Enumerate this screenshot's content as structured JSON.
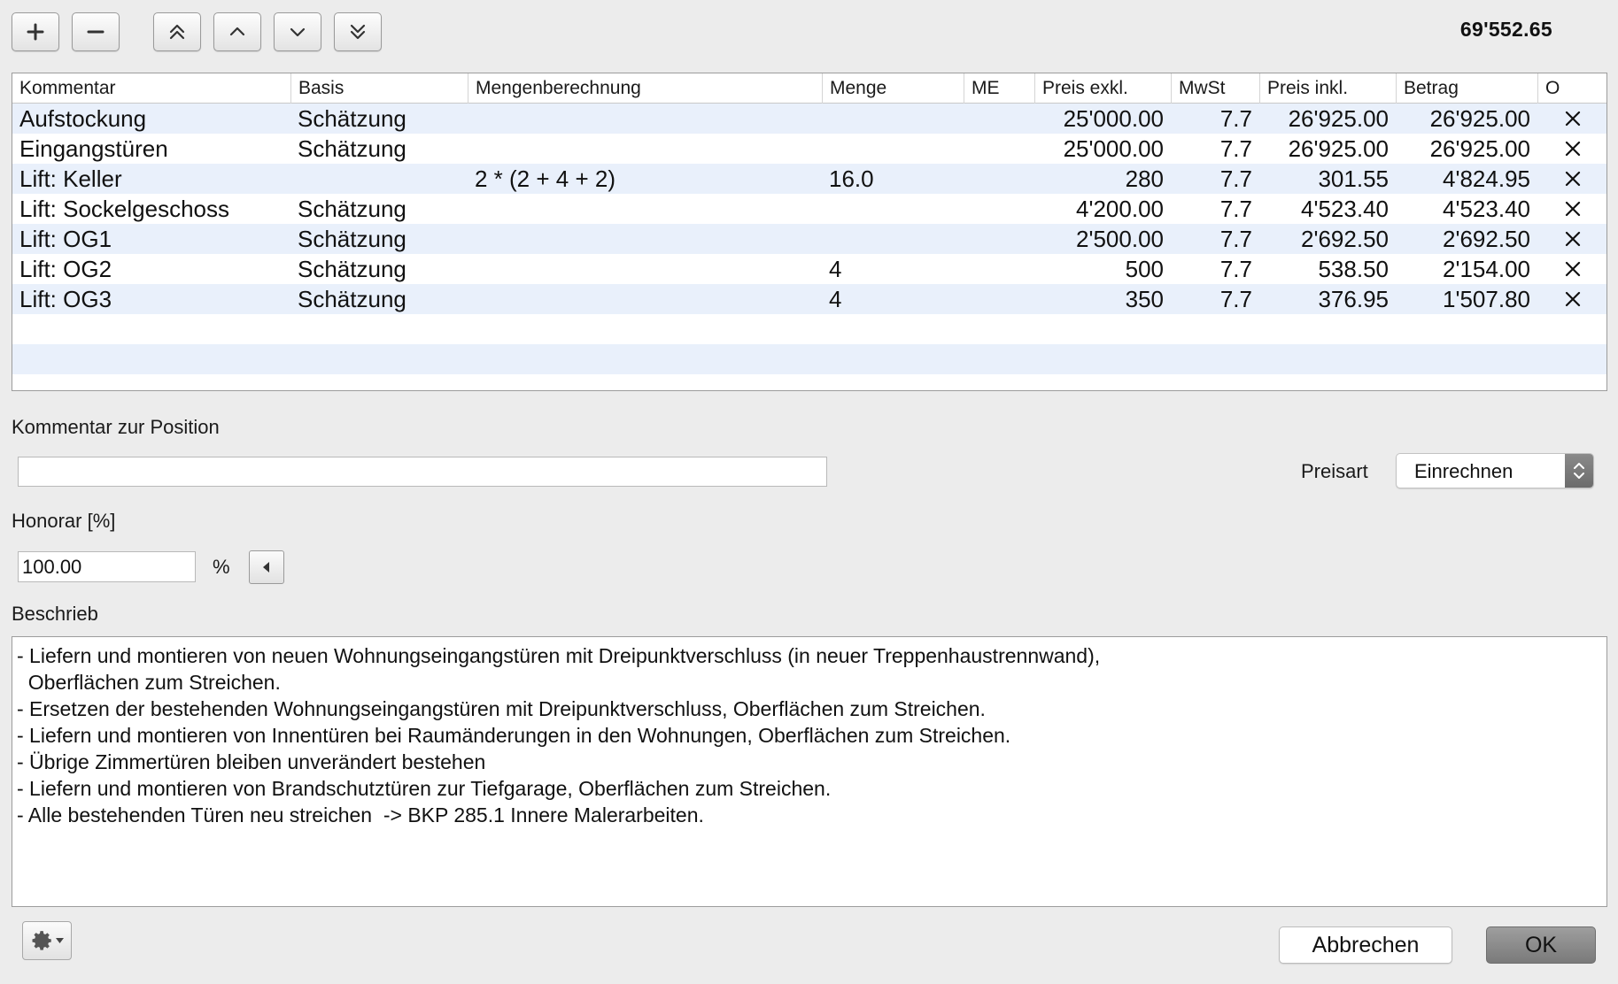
{
  "toolbar": {
    "add_icon": "plus-icon",
    "remove_icon": "minus-icon",
    "move_top_icon": "double-chevron-up-icon",
    "move_up_icon": "chevron-up-icon",
    "move_down_icon": "chevron-down-icon",
    "move_bottom_icon": "double-chevron-down-icon",
    "total": "69'552.65"
  },
  "table": {
    "columns": [
      "Kommentar",
      "Basis",
      "Mengenberechnung",
      "Menge",
      "ME",
      "Preis exkl.",
      "MwSt",
      "Preis inkl.",
      "Betrag",
      "O"
    ],
    "rows": [
      {
        "kommentar": "Aufstockung",
        "basis": "Schätzung",
        "mengenberechnung": "",
        "menge": "",
        "me": "",
        "preis_exkl": "25'000.00",
        "mwst": "7.7",
        "preis_inkl": "26'925.00",
        "betrag": "26'925.00"
      },
      {
        "kommentar": "Eingangstüren",
        "basis": "Schätzung",
        "mengenberechnung": "",
        "menge": "",
        "me": "",
        "preis_exkl": "25'000.00",
        "mwst": "7.7",
        "preis_inkl": "26'925.00",
        "betrag": "26'925.00"
      },
      {
        "kommentar": "Lift: Keller",
        "basis": "",
        "mengenberechnung": "2 * (2 + 4 + 2)",
        "menge": "16.0",
        "me": "",
        "preis_exkl": "280",
        "mwst": "7.7",
        "preis_inkl": "301.55",
        "betrag": "4'824.95"
      },
      {
        "kommentar": "Lift: Sockelgeschoss",
        "basis": "Schätzung",
        "mengenberechnung": "",
        "menge": "",
        "me": "",
        "preis_exkl": "4'200.00",
        "mwst": "7.7",
        "preis_inkl": "4'523.40",
        "betrag": "4'523.40"
      },
      {
        "kommentar": "Lift: OG1",
        "basis": "Schätzung",
        "mengenberechnung": "",
        "menge": "",
        "me": "",
        "preis_exkl": "2'500.00",
        "mwst": "7.7",
        "preis_inkl": "2'692.50",
        "betrag": "2'692.50"
      },
      {
        "kommentar": "Lift: OG2",
        "basis": "Schätzung",
        "mengenberechnung": "",
        "menge": "4",
        "me": "",
        "preis_exkl": "500",
        "mwst": "7.7",
        "preis_inkl": "538.50",
        "betrag": "2'154.00"
      },
      {
        "kommentar": "Lift: OG3",
        "basis": "Schätzung",
        "mengenberechnung": "",
        "menge": "4",
        "me": "",
        "preis_exkl": "350",
        "mwst": "7.7",
        "preis_inkl": "376.95",
        "betrag": "1'507.80"
      }
    ]
  },
  "form": {
    "kommentar_label": "Kommentar zur Position",
    "kommentar_value": "",
    "preisart_label": "Preisart",
    "preisart_value": "Einrechnen",
    "honorar_label": "Honorar [%]",
    "honorar_value": "100.00",
    "percent_sign": "%",
    "beschrieb_label": "Beschrieb",
    "beschrieb_lines": [
      "- Liefern und montieren von neuen Wohnungseingangstüren mit Dreipunktverschluss (in neuer Treppenhaustrennwand),",
      "  Oberflächen zum Streichen.",
      "- Ersetzen der bestehenden Wohnungseingangstüren mit Dreipunktverschluss, Oberflächen zum Streichen.",
      "- Liefern und montieren von Innentüren bei Raumänderungen in den Wohnungen, Oberflächen zum Streichen.",
      "- Übrige Zimmertüren bleiben unverändert bestehen",
      "- Liefern und montieren von Brandschutztüren zur Tiefgarage, Oberflächen zum Streichen.",
      "- Alle bestehenden Türen neu streichen  -> BKP 285.1 Innere Malerarbeiten."
    ]
  },
  "footer": {
    "gear_icon": "gear-icon",
    "cancel_label": "Abbrechen",
    "ok_label": "OK"
  },
  "colors": {
    "row_alt": "#e9f0fb",
    "window_bg": "#ececec",
    "ok_button": "#8a8a8a"
  }
}
